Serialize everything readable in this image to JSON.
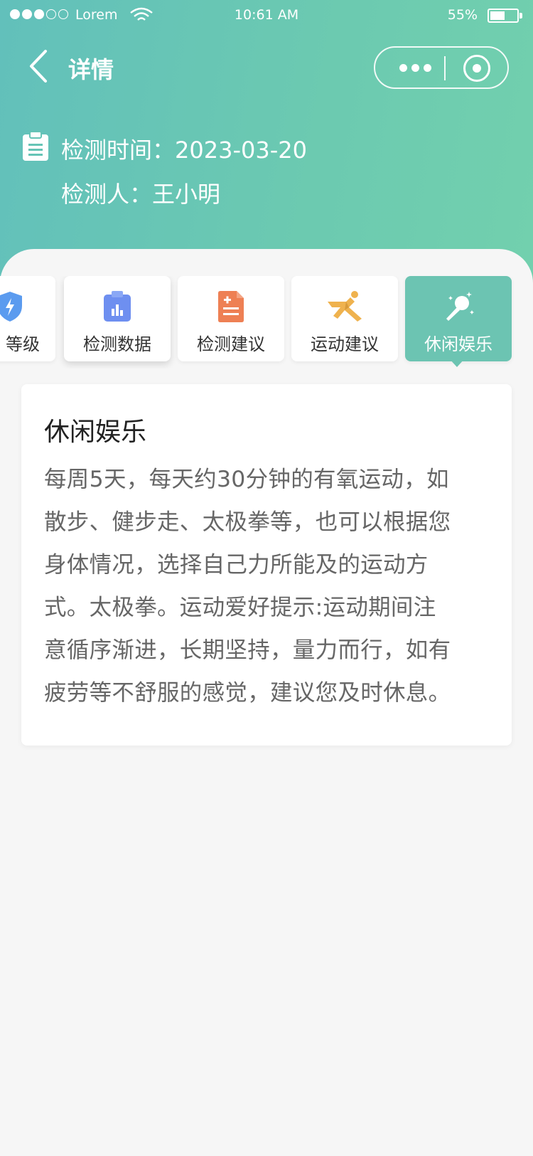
{
  "status_bar": {
    "carrier": "Lorem",
    "time": "10:61 AM",
    "battery_percent": "55%",
    "battery_level": 0.55,
    "signal_strength": 3,
    "signal_total": 5
  },
  "nav": {
    "title": "详情",
    "back_icon": "chevron-left-icon",
    "more_icon": "more-dots-icon",
    "close_icon": "target-circle-icon"
  },
  "info": {
    "detect_time": "检测时间：2023-03-20",
    "detector": "检测人：王小明",
    "icon": "clipboard-icon"
  },
  "tabs": [
    {
      "label": "等级",
      "icon": "shield-bolt-icon",
      "color": "#5b9bef",
      "active": false
    },
    {
      "label": "检测数据",
      "icon": "chart-clipboard-icon",
      "color": "#6e8ff0",
      "active": false
    },
    {
      "label": "检测建议",
      "icon": "doc-plus-icon",
      "color": "#ee8054",
      "active": false
    },
    {
      "label": "运动建议",
      "icon": "runner-icon",
      "color": "#efb24e",
      "active": false
    },
    {
      "label": "休闲娱乐",
      "icon": "microphone-icon",
      "color": "#ffffff",
      "active": true
    }
  ],
  "content": {
    "title": "休闲娱乐",
    "lines": [
      "每周5天，每天约30分钟的有氧运动，如",
      "散步、健步走、太极拳等，也可以根据您",
      "身体情况，选择自己力所能及的运动方",
      "式。太极拳。运动爱好提示:运动期间注",
      "意循序渐进，长期坚持，量力而行，如有",
      "疲劳等不舒服的感觉，建议您及时休息。"
    ]
  },
  "colors": {
    "header_start": "#62c0bb",
    "header_end": "#72d0ae",
    "active_tab": "#6cc4b2",
    "page_bg": "#f6f6f6"
  }
}
